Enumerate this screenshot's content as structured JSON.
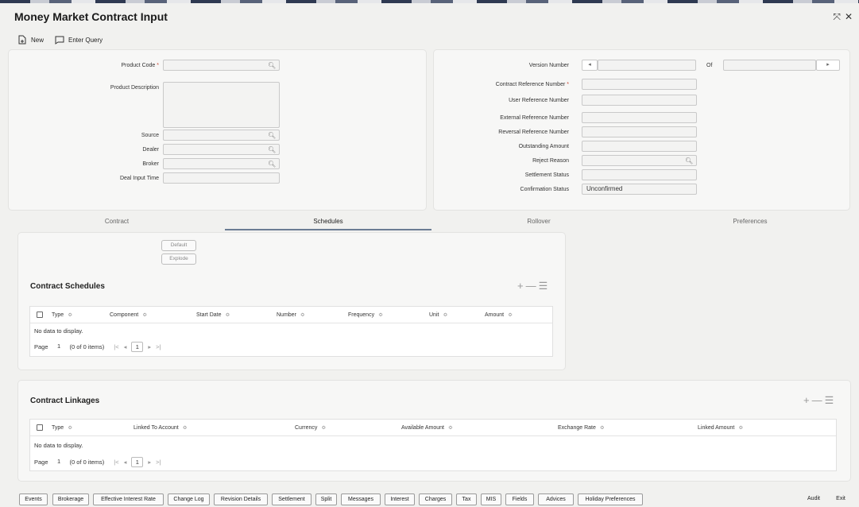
{
  "window": {
    "title": "Money Market Contract Input",
    "resize_icon": "expand-icon",
    "close_icon": "close-icon"
  },
  "toolbar": {
    "new_label": "New",
    "enter_query_label": "Enter Query"
  },
  "left_form": {
    "product_code_label": "Product Code",
    "product_description_label": "Product Description",
    "source_label": "Source",
    "dealer_label": "Dealer",
    "broker_label": "Broker",
    "deal_input_time_label": "Deal Input Time",
    "required_mark": "*"
  },
  "right_form": {
    "version_number_label": "Version Number",
    "of_label": "Of",
    "contract_reference_label": "Contract Reference Number",
    "user_reference_label": "User Reference Number",
    "external_reference_label": "External Reference Number",
    "reversal_reference_label": "Reversal Reference Number",
    "outstanding_amount_label": "Outstanding Amount",
    "reject_reason_label": "Reject Reason",
    "settlement_status_label": "Settlement Status",
    "confirmation_status_label": "Confirmation Status",
    "confirmation_status_value": "Unconfirmed",
    "required_mark": "*"
  },
  "tabs": [
    {
      "label": "Contract",
      "active": false
    },
    {
      "label": "Schedules",
      "active": true
    },
    {
      "label": "Rollover",
      "active": false
    },
    {
      "label": "Preferences",
      "active": false
    }
  ],
  "schedules": {
    "default_label": "Default",
    "explode_label": "Explode",
    "section_title": "Contract Schedules",
    "columns": [
      "Type",
      "Component",
      "Start Date",
      "Number",
      "Frequency",
      "Unit",
      "Amount"
    ],
    "no_data": "No data to display.",
    "page_label": "Page",
    "page_number": "1",
    "items_text": "(0 of 0 items)",
    "current_page": "1"
  },
  "linkages": {
    "section_title": "Contract Linkages",
    "columns": [
      "Type",
      "Linked To Account",
      "Currency",
      "Available Amount",
      "Exchange Rate",
      "Linked Amount"
    ],
    "no_data": "No data to display.",
    "page_label": "Page",
    "page_number": "1",
    "items_text": "(0 of 0 items)",
    "current_page": "1"
  },
  "bottom_buttons": [
    "Events",
    "Brokerage",
    "Effective Interest Rate",
    "Change Log",
    "Revision Details",
    "Settlement",
    "Split",
    "Messages",
    "Interest",
    "Charges",
    "Tax",
    "MIS",
    "Fields",
    "Advices",
    "Holiday Preferences"
  ],
  "footer": {
    "audit_label": "Audit",
    "exit_label": "Exit"
  },
  "glyphs": {
    "sort": "≎",
    "first": "|<",
    "prev": "◂",
    "next": "▸",
    "last": ">|",
    "left_arrow": "◂",
    "right_arrow": "▸",
    "plus": "+",
    "minus": "—",
    "list": "☰"
  },
  "colors": {
    "required": "#c74634",
    "active_tab_underline": "#6b7c93",
    "background": "#f1f1ef"
  }
}
